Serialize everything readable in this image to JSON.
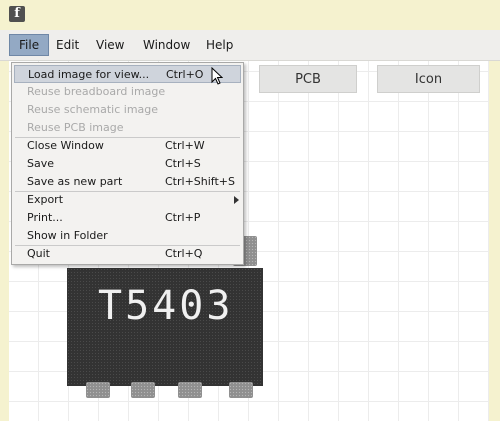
{
  "titlebar": {
    "icon": "f",
    "icon_name": "fritzing-app-icon"
  },
  "menubar": {
    "items": [
      {
        "label": "File"
      },
      {
        "label": "Edit"
      },
      {
        "label": "View"
      },
      {
        "label": "Window"
      },
      {
        "label": "Help"
      }
    ]
  },
  "tabs": [
    {
      "label": "PCB"
    },
    {
      "label": "Icon"
    }
  ],
  "part": {
    "label": "T5403"
  },
  "file_menu": {
    "items": [
      {
        "label": "Load image for view...",
        "shortcut": "Ctrl+O",
        "state": "highlighted"
      },
      {
        "label": "Reuse breadboard image",
        "shortcut": "",
        "state": "disabled"
      },
      {
        "label": "Reuse schematic image",
        "shortcut": "",
        "state": "disabled"
      },
      {
        "label": "Reuse PCB image",
        "shortcut": "",
        "state": "disabled"
      },
      {
        "label": "Close Window",
        "shortcut": "Ctrl+W",
        "state": "enabled"
      },
      {
        "label": "Save",
        "shortcut": "Ctrl+S",
        "state": "enabled"
      },
      {
        "label": "Save as new part",
        "shortcut": "Ctrl+Shift+S",
        "state": "enabled"
      },
      {
        "label": "Export",
        "shortcut": "",
        "state": "submenu"
      },
      {
        "label": "Print...",
        "shortcut": "Ctrl+P",
        "state": "enabled"
      },
      {
        "label": "Show in Folder",
        "shortcut": "",
        "state": "enabled"
      },
      {
        "label": "Quit",
        "shortcut": "Ctrl+Q",
        "state": "enabled"
      }
    ]
  },
  "colors": {
    "titlebar_bg": "#f5f2cf",
    "menu_active_bg": "#93a9c4",
    "menu_highlight_bg": "#cfd4dc",
    "chip_body": "#333333",
    "chip_pin": "#8f8f8f"
  }
}
